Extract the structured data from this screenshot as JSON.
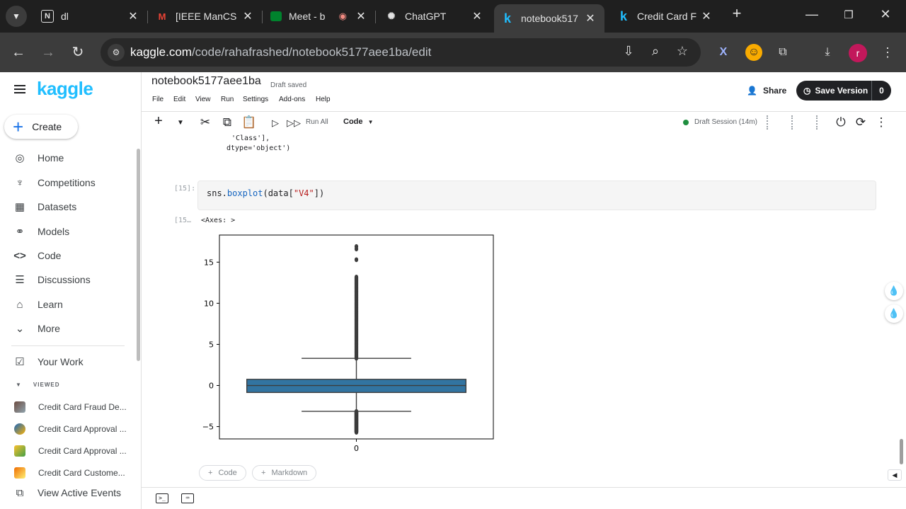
{
  "browser": {
    "tabs": [
      {
        "title": "dl",
        "icon": "notion-icon"
      },
      {
        "title": "[IEEE ManCS",
        "icon": "gmail-icon"
      },
      {
        "title": "Meet - b",
        "icon": "meet-icon"
      },
      {
        "title": "ChatGPT",
        "icon": "chatgpt-icon"
      },
      {
        "title": "notebook517",
        "icon": "kaggle-icon",
        "active": true
      },
      {
        "title": "Credit Card F",
        "icon": "kaggle-icon"
      }
    ],
    "url_domain": "kaggle.com",
    "url_path": "/code/rahafrashed/notebook5177aee1ba/edit",
    "profile_initial": "r"
  },
  "sidebar": {
    "logo": "kaggle",
    "create_label": "Create",
    "nav": [
      {
        "label": "Home",
        "icon": "compass-icon"
      },
      {
        "label": "Competitions",
        "icon": "trophy-icon"
      },
      {
        "label": "Datasets",
        "icon": "table-icon"
      },
      {
        "label": "Models",
        "icon": "models-icon"
      },
      {
        "label": "Code",
        "icon": "code-icon",
        "active": true
      },
      {
        "label": "Discussions",
        "icon": "discussion-icon"
      },
      {
        "label": "Learn",
        "icon": "graduation-cap-icon"
      },
      {
        "label": "More",
        "icon": "chevron-down-icon"
      }
    ],
    "your_work": "Your Work",
    "viewed_label": "VIEWED",
    "recent": [
      "Credit Card Fraud De...",
      "Credit Card Approval ...",
      "Credit Card Approval ...",
      "Credit Card Custome..."
    ],
    "view_events": "View Active Events"
  },
  "notebook": {
    "title": "notebook5177aee1ba",
    "status": "Draft saved",
    "menu": [
      "File",
      "Edit",
      "View",
      "Run",
      "Settings",
      "Add-ons",
      "Help"
    ],
    "share_label": "Share",
    "save_label": "Save Version",
    "save_count": "0",
    "run_all": "Run All",
    "cell_type": "Code",
    "session": "Draft Session (14m)"
  },
  "cells": {
    "prev_output_line1": "'Class'],",
    "prev_output_line2": "dtype='object')",
    "prompt_in": "[15]:",
    "prompt_out": "[15…",
    "code_prefix": "sns.",
    "code_fn": "boxplot",
    "code_mid": "(data[",
    "code_str": "\"V4\"",
    "code_suffix": "])",
    "output_text": "<Axes: >",
    "add_code": "Code",
    "add_markdown": "Markdown"
  },
  "chart_data": {
    "type": "box",
    "categories": [
      "0"
    ],
    "yticks": [
      -5,
      0,
      5,
      10,
      15
    ],
    "ylim": [
      -6.5,
      18.3
    ],
    "box": {
      "q1": -0.85,
      "median": 0.0,
      "q3": 0.75,
      "whisker_low": -3.15,
      "whisker_high": 3.3
    },
    "outliers_high_range": [
      3.3,
      13.2
    ],
    "outliers_high_extra": [
      15.3,
      16.6,
      16.9
    ],
    "outliers_low_range": [
      -5.7,
      -3.15
    ],
    "color": "#3274a1"
  }
}
